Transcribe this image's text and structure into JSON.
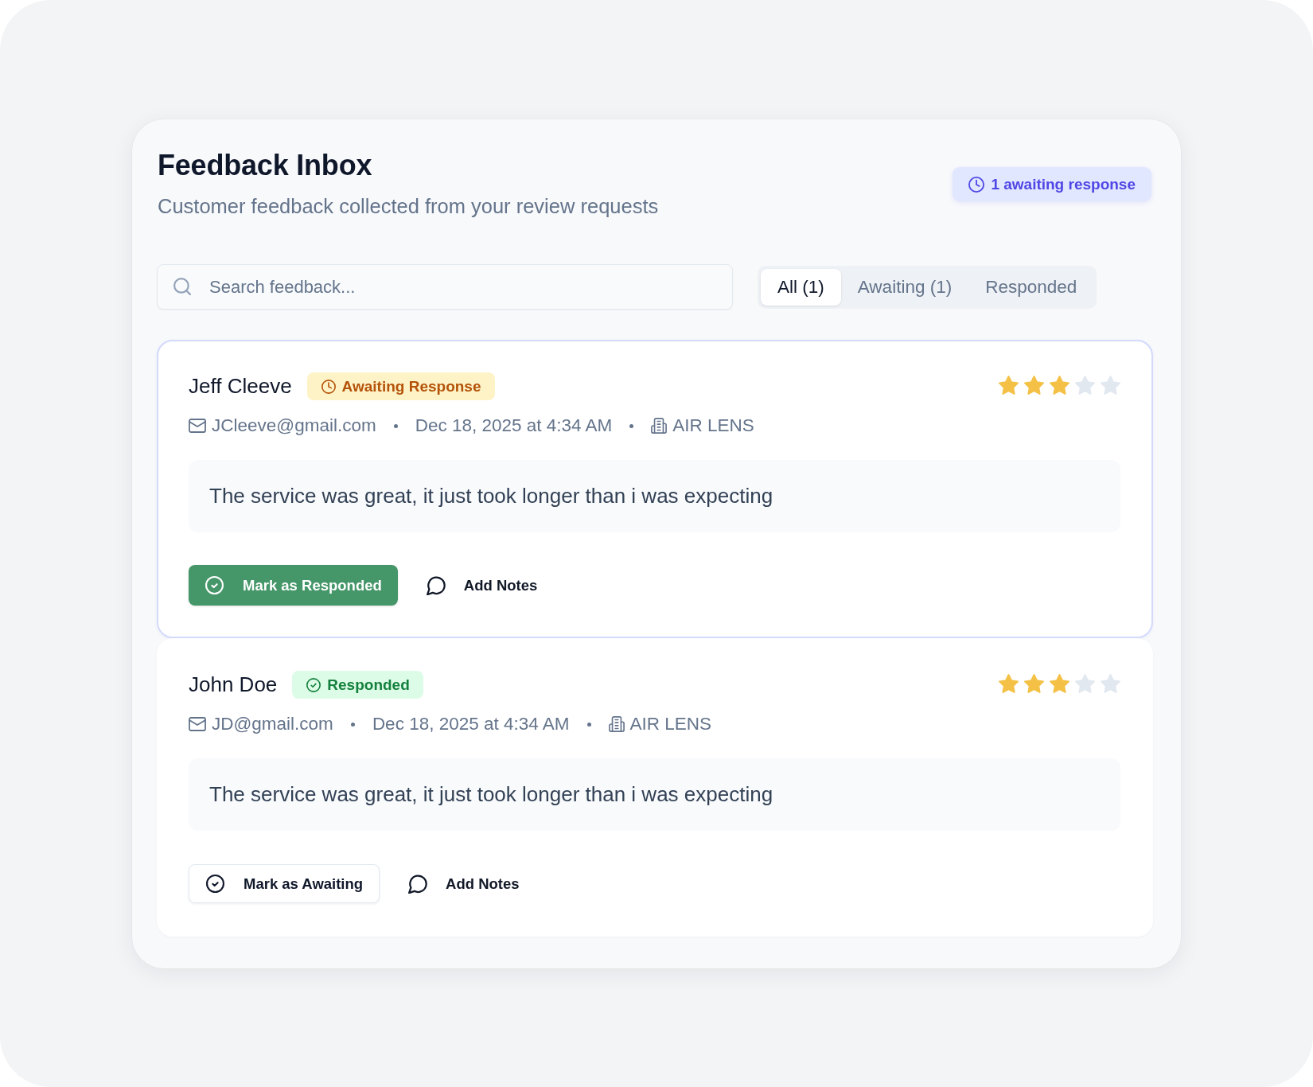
{
  "header": {
    "title": "Feedback Inbox",
    "subtitle": "Customer feedback collected from your review requests",
    "awaiting_badge": "1 awaiting response"
  },
  "search": {
    "placeholder": "Search feedback..."
  },
  "tabs": [
    {
      "label": "All (1)",
      "selected": true
    },
    {
      "label": "Awaiting (1)",
      "selected": false
    },
    {
      "label": "Responded",
      "selected": false
    }
  ],
  "feedback": [
    {
      "kind": "awaiting",
      "name": "Jeff Cleeve",
      "status": "Awaiting Response",
      "stars": 3,
      "email": "JCleeve@gmail.com",
      "date": "Dec 18, 2025 at 4:34 AM",
      "business": "AIR LENS",
      "message": "The service was great, it just took longer than i was expecting",
      "status_action": "Mark as Responded",
      "notes_action": "Add Notes"
    },
    {
      "kind": "responded",
      "name": "John Doe",
      "status": "Responded",
      "stars": 3,
      "email": "JD@gmail.com",
      "date": "Dec 18, 2025 at 4:34 AM",
      "business": "AIR LENS",
      "message": "The service was great, it just took longer than i was expecting",
      "status_action": "Mark as Awaiting",
      "notes_action": "Add Notes"
    }
  ]
}
